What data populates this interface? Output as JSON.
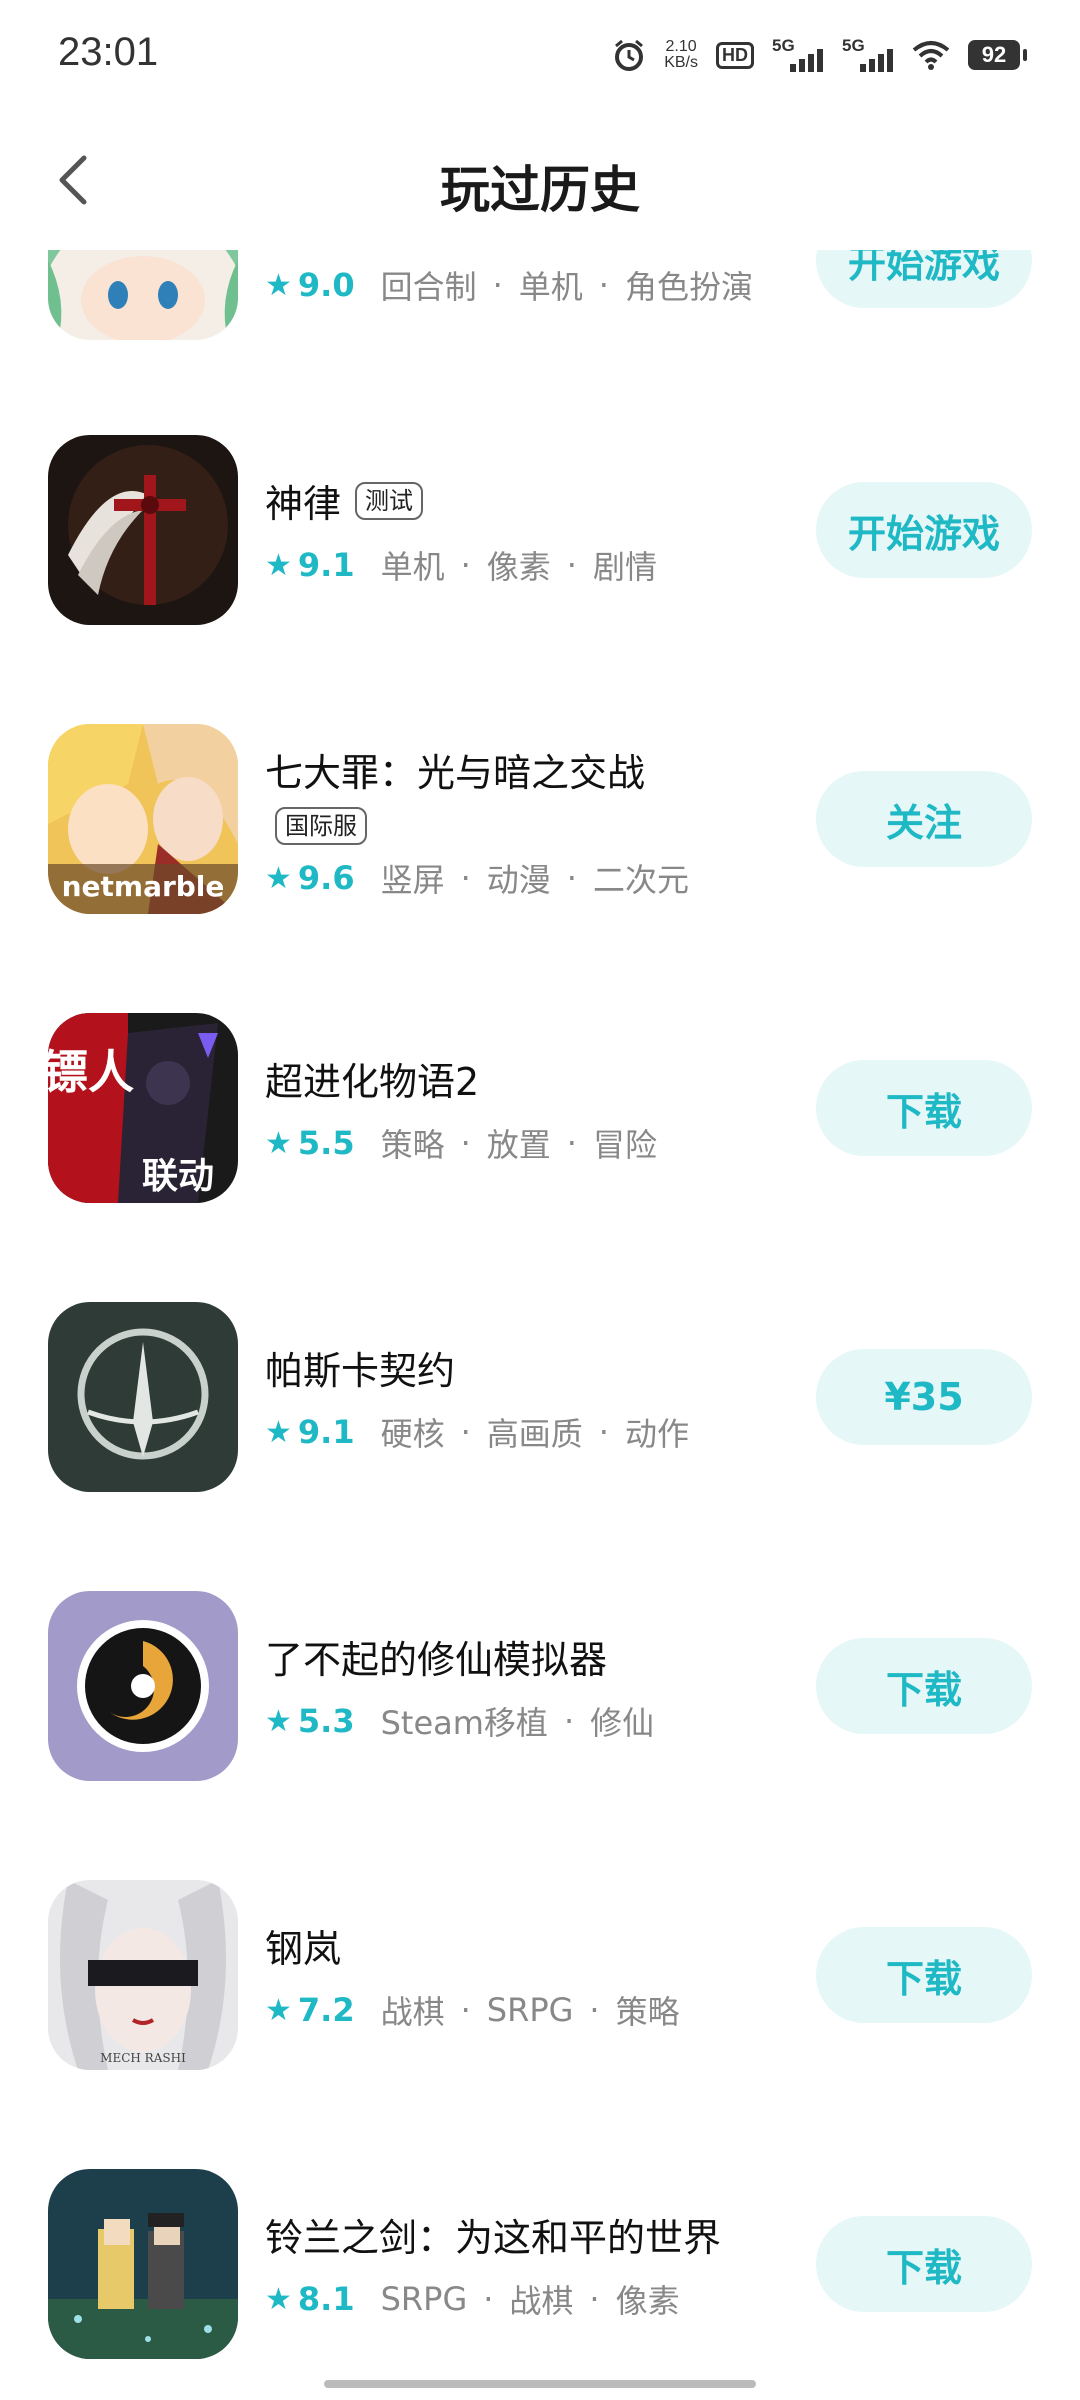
{
  "status_bar": {
    "time": "23:01",
    "net_speed_value": "2.10",
    "net_speed_unit": "KB/s",
    "hd_label": "HD",
    "signal1": "5G",
    "signal2": "5G",
    "battery": "92"
  },
  "header": {
    "title": "玩过历史"
  },
  "items": [
    {
      "name": "",
      "badge": "",
      "score": "9.0",
      "tags": [
        "回合制",
        "单机",
        "角色扮演"
      ],
      "button": "开始游戏"
    },
    {
      "name": "神律",
      "badge": "测试",
      "score": "9.1",
      "tags": [
        "单机",
        "像素",
        "剧情"
      ],
      "button": "开始游戏"
    },
    {
      "name": "七大罪：光与暗之交战",
      "badge": "国际服",
      "score": "9.6",
      "tags": [
        "竖屏",
        "动漫",
        "二次元"
      ],
      "button": "关注",
      "icon_text": "netmarble"
    },
    {
      "name": "超进化物语2",
      "badge": "",
      "score": "5.5",
      "tags": [
        "策略",
        "放置",
        "冒险"
      ],
      "button": "下载",
      "icon_text": "镖人",
      "icon_text2": "联动"
    },
    {
      "name": "帕斯卡契约",
      "badge": "",
      "score": "9.1",
      "tags": [
        "硬核",
        "高画质",
        "动作"
      ],
      "button": "¥35"
    },
    {
      "name": "了不起的修仙模拟器",
      "badge": "",
      "score": "5.3",
      "tags": [
        "Steam移植",
        "修仙"
      ],
      "button": "下载"
    },
    {
      "name": "钢岚",
      "badge": "",
      "score": "7.2",
      "tags": [
        "战棋",
        "SRPG",
        "策略"
      ],
      "button": "下载",
      "icon_text": "MECH RASHI"
    },
    {
      "name": "铃兰之剑：为这和平的世界",
      "badge": "",
      "score": "8.1",
      "tags": [
        "SRPG",
        "战棋",
        "像素"
      ],
      "button": "下载"
    }
  ],
  "colors": {
    "accent": "#1fb8c5",
    "button_bg": "#e6f7f8",
    "tag_text": "#888888"
  }
}
